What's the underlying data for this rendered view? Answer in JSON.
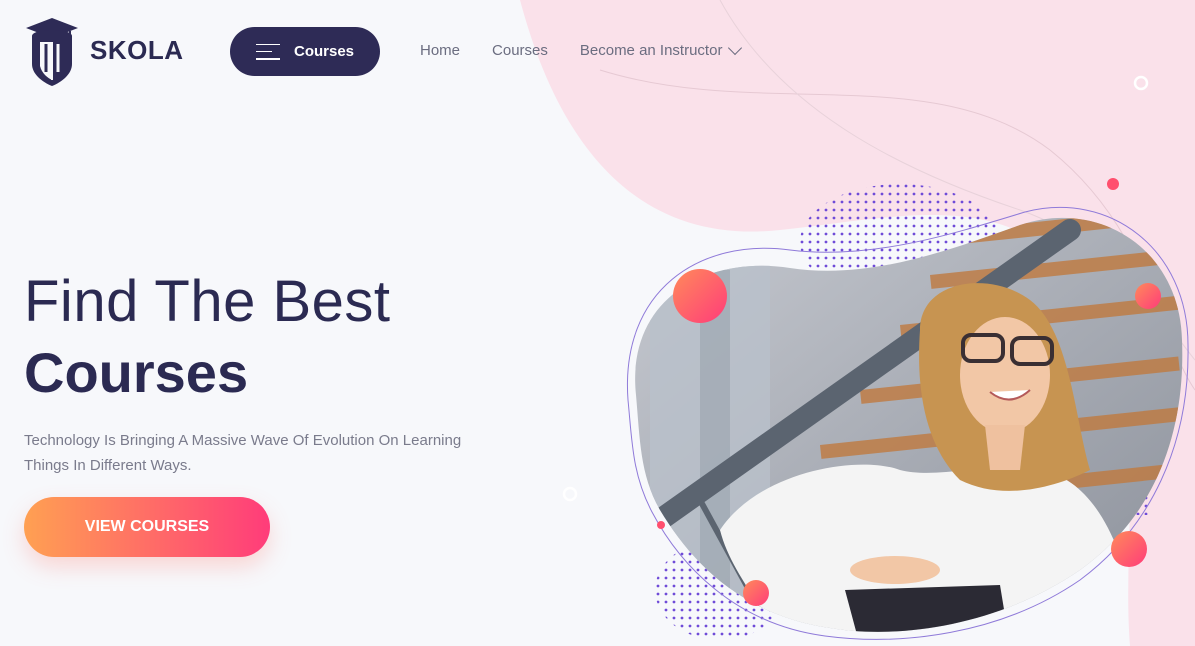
{
  "brand": {
    "name": "SKOLA",
    "logo_icon": "graduation-pencil-icon"
  },
  "header": {
    "courses_button": {
      "label": "Courses",
      "icon": "menu-icon"
    },
    "nav": [
      {
        "label": "Home"
      },
      {
        "label": "Courses"
      },
      {
        "label": "Become an Instructor",
        "icon": "chevron-down-icon"
      }
    ]
  },
  "hero": {
    "title_light": "Find The Best",
    "title_bold": "Courses",
    "description": "Technology Is Bringing A Massive Wave Of Evolution On Learning Things In Different Ways.",
    "cta_label": "VIEW COURSES",
    "image_icon": "student-photo-icon"
  },
  "colors": {
    "primary": "#2e2b56",
    "accent_start": "#ffa052",
    "accent_end": "#ff3c7a",
    "blob_pink": "#fae1ea",
    "dots": "#6f4bd8",
    "background": "#f7f8fb"
  }
}
